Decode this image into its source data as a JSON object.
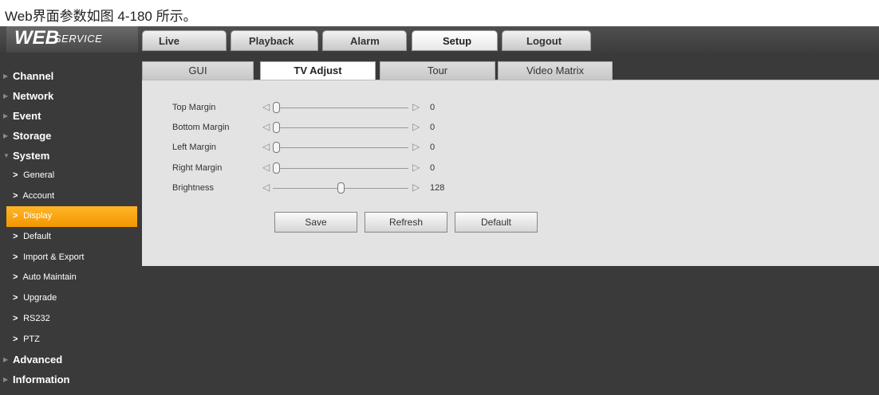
{
  "caption": "Web界面参数如图 4-180 所示。",
  "header": {
    "logo_main": "WEB",
    "logo_sub": "SERVICE",
    "tabs": [
      {
        "label": "Live"
      },
      {
        "label": "Playback"
      },
      {
        "label": "Alarm"
      },
      {
        "label": "Setup"
      },
      {
        "label": "Logout"
      }
    ]
  },
  "sidebar": {
    "categories": {
      "channel": "Channel",
      "network": "Network",
      "event": "Event",
      "storage": "Storage",
      "system": "System",
      "advanced": "Advanced",
      "information": "Information"
    },
    "system_items": [
      {
        "label": "General"
      },
      {
        "label": "Account"
      },
      {
        "label": "Display"
      },
      {
        "label": "Default"
      },
      {
        "label": "Import & Export"
      },
      {
        "label": "Auto Maintain"
      },
      {
        "label": "Upgrade"
      },
      {
        "label": "RS232"
      },
      {
        "label": "PTZ"
      }
    ]
  },
  "subtabs": [
    {
      "label": "GUI"
    },
    {
      "label": "TV Adjust"
    },
    {
      "label": "Tour"
    },
    {
      "label": "Video Matrix"
    }
  ],
  "tv_adjust": {
    "rows": [
      {
        "label": "Top Margin",
        "value": "0",
        "level": 0
      },
      {
        "label": "Bottom Margin",
        "value": "0",
        "level": 0
      },
      {
        "label": "Left Margin",
        "value": "0",
        "level": 0
      },
      {
        "label": "Right Margin",
        "value": "0",
        "level": 0
      },
      {
        "label": "Brightness",
        "value": "128",
        "level": 0.5
      }
    ],
    "buttons": {
      "save": "Save",
      "refresh": "Refresh",
      "default": "Default"
    }
  },
  "colors": {
    "accent": "#f5a000",
    "background": "#3a3a3a",
    "panel": "#e3e3e3"
  }
}
